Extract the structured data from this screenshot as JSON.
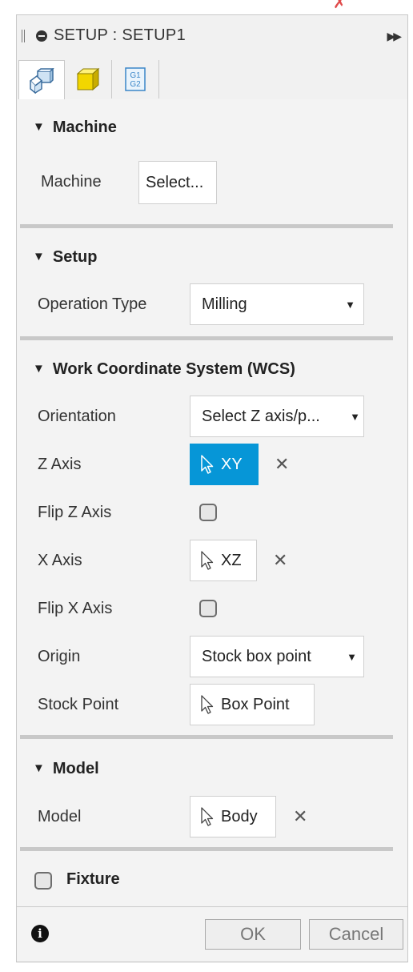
{
  "title": "SETUP : SETUP1",
  "tabs": [
    {
      "icon": "setup-tool-icon"
    },
    {
      "icon": "stock-box-icon"
    },
    {
      "icon": "g1-g2-post-icon",
      "label_top": "G1",
      "label_bottom": "G2"
    }
  ],
  "machine": {
    "heading": "Machine",
    "label": "Machine",
    "button": "Select..."
  },
  "setup": {
    "heading": "Setup",
    "operation_type_label": "Operation Type",
    "operation_type_value": "Milling"
  },
  "wcs": {
    "heading": "Work Coordinate System (WCS)",
    "orientation_label": "Orientation",
    "orientation_value": "Select Z axis/p...",
    "z_axis_label": "Z Axis",
    "z_axis_value": "XY",
    "flip_z_label": "Flip Z Axis",
    "x_axis_label": "X Axis",
    "x_axis_value": "XZ",
    "flip_x_label": "Flip X Axis",
    "origin_label": "Origin",
    "origin_value": "Stock box point",
    "stock_point_label": "Stock Point",
    "stock_point_value": "Box Point"
  },
  "model": {
    "heading": "Model",
    "label": "Model",
    "value": "Body"
  },
  "fixture": {
    "label": "Fixture"
  },
  "footer": {
    "ok": "OK",
    "cancel": "Cancel"
  },
  "colors": {
    "accent": "#0696d7",
    "panel_bg": "#f3f3f3",
    "divider": "#c8c8c8"
  }
}
